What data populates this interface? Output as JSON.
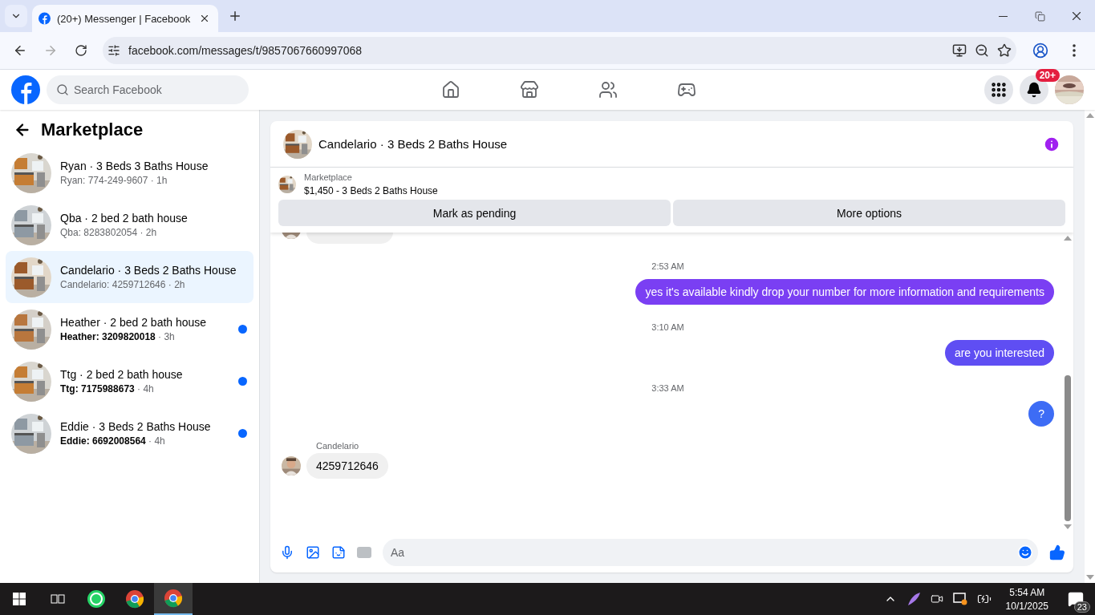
{
  "browser": {
    "tab_title": "(20+) Messenger | Facebook",
    "url": "facebook.com/messages/t/9857067660997068"
  },
  "header": {
    "search_placeholder": "Search Facebook",
    "notification_badge": "20+"
  },
  "sidebar": {
    "title": "Marketplace",
    "conversations": [
      {
        "title": "Ryan · 3 Beds 3 Baths House",
        "preview": "Ryan: 774-249-9607",
        "time": "· 1h",
        "selected": false,
        "unread": false
      },
      {
        "title": "Qba · 2 bed 2 bath house",
        "preview": "Qba: 8283802054",
        "time": "· 2h",
        "selected": false,
        "unread": false
      },
      {
        "title": "Candelario · 3 Beds 2 Baths House",
        "preview": "Candelario: 4259712646",
        "time": "· 2h",
        "selected": true,
        "unread": false
      },
      {
        "title": "Heather · 2 bed 2 bath house",
        "preview": "Heather: 3209820018",
        "time": "· 3h",
        "selected": false,
        "unread": true
      },
      {
        "title": "Ttg · 2 bed 2 bath house",
        "preview": "Ttg: 7175988673",
        "time": "· 4h",
        "selected": false,
        "unread": true
      },
      {
        "title": "Eddie · 3 Beds 2 Baths House",
        "preview": "Eddie: 6692008564",
        "time": "· 4h",
        "selected": false,
        "unread": true
      }
    ]
  },
  "chat": {
    "title": "Candelario · 3 Beds 2 Baths House",
    "listing": {
      "label": "Marketplace",
      "name": "$1,450 - 3 Beds 2 Baths House"
    },
    "actions": [
      "Mark as pending",
      "More options"
    ],
    "messages": [
      {
        "kind": "partial"
      },
      {
        "kind": "time",
        "text": "2:53 AM"
      },
      {
        "kind": "sent",
        "text": "yes it's available kindly drop your number for more information and requirements"
      },
      {
        "kind": "time",
        "text": "3:10 AM"
      },
      {
        "kind": "sent",
        "text": "are you interested"
      },
      {
        "kind": "time",
        "text": "3:33 AM"
      },
      {
        "kind": "sent",
        "text": "?"
      },
      {
        "kind": "received",
        "sender": "Candelario",
        "text": "4259712646"
      }
    ],
    "composer_placeholder": "Aa"
  },
  "taskbar": {
    "time": "5:54 AM",
    "date": "10/1/2025",
    "notification_count": "23"
  }
}
